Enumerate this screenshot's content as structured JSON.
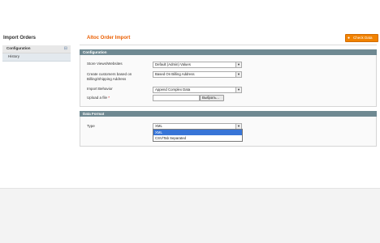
{
  "sidebar": {
    "title": "Import Orders",
    "items": [
      {
        "label": "Configuration",
        "icon": "collapse-icon",
        "active": true
      },
      {
        "label": "History",
        "active": false
      }
    ]
  },
  "header": {
    "title": "Altoc Order Import",
    "check_button": {
      "label": "Check Data",
      "icon": "check-circle-icon"
    }
  },
  "configuration": {
    "legend": "Configuration",
    "store_views": {
      "label": "Store Views/Websites",
      "value": "Default (Admin) Values"
    },
    "create_customers": {
      "label_line1": "Create customers based on",
      "label_line2": "Billing/Shipping Address",
      "value": "Based On Billing Address"
    },
    "import_behavior": {
      "label": "Import Behavior",
      "value": "Append Complex Data"
    },
    "upload_file": {
      "label": "Upload a file",
      "required_mark": "*",
      "browse_label": "Выбрать..."
    }
  },
  "data_format": {
    "legend": "Data Format",
    "type": {
      "label": "Type",
      "value": "XML",
      "options": [
        "XML",
        "CSV/Tab Separated"
      ],
      "highlighted": "XML"
    }
  },
  "colors": {
    "accent": "#eb5e00",
    "button": "#f18200",
    "fieldset_header": "#6f8992",
    "highlight": "#3875d7"
  }
}
